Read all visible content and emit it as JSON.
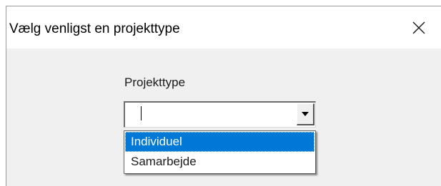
{
  "window": {
    "title": "Vælg venligst en projekttype",
    "close_glyph": "close-icon"
  },
  "form": {
    "label": "Projekttype",
    "combo_value": "",
    "dropdown_icon": "chevron-down-icon",
    "options": [
      {
        "label": "Individuel",
        "selected": true
      },
      {
        "label": "Samarbejde",
        "selected": false
      }
    ]
  },
  "colors": {
    "selection": "#0078d7",
    "client_background": "#f0f0f0",
    "titlebar_background": "#ffffff"
  }
}
